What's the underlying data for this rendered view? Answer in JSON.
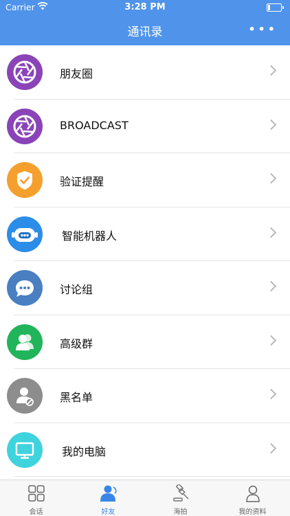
{
  "status": {
    "carrier": "Carrier",
    "time": "3:28 PM"
  },
  "header": {
    "title": "通讯录",
    "more_label": "•••"
  },
  "contacts": [
    {
      "label": "朋友圈",
      "icon": "aperture-icon",
      "color": "#8a44b8"
    },
    {
      "label": "BROADCAST",
      "icon": "aperture-icon",
      "color": "#8a44b8"
    },
    {
      "label": "验证提醒",
      "icon": "shield-check-icon",
      "color": "#f5a02c"
    },
    {
      "label": "智能机器人",
      "icon": "robot-icon",
      "color": "#2b8de8"
    },
    {
      "label": "讨论组",
      "icon": "chat-bubble-icon",
      "color": "#4a7fc2"
    },
    {
      "label": "高级群",
      "icon": "group-icon",
      "color": "#22b45a"
    },
    {
      "label": "黑名单",
      "icon": "blocked-user-icon",
      "color": "#8d8d8d"
    },
    {
      "label": "我的电脑",
      "icon": "monitor-icon",
      "color": "#3fd3dd"
    }
  ],
  "tabs": [
    {
      "label": "会话",
      "icon": "grid-icon",
      "active": false
    },
    {
      "label": "好友",
      "icon": "friends-icon",
      "active": true
    },
    {
      "label": "海拍",
      "icon": "gavel-icon",
      "active": false
    },
    {
      "label": "我的资料",
      "icon": "profile-icon",
      "active": false
    }
  ],
  "colors": {
    "header": "#4f93ea",
    "active_tab": "#3a86e8"
  }
}
